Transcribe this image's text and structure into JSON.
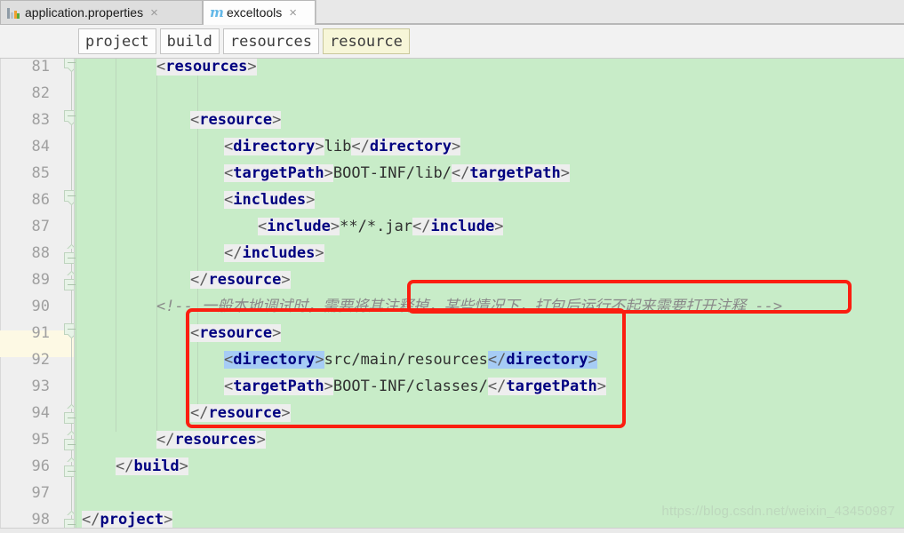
{
  "tabs": [
    {
      "label": "application.properties",
      "icon": "properties-file-icon",
      "close": "×",
      "active": false
    },
    {
      "label": "exceltools",
      "icon": "maven-module-icon",
      "close": "×",
      "active": true
    }
  ],
  "breadcrumbs": [
    {
      "label": "project",
      "current": false
    },
    {
      "label": "build",
      "current": false
    },
    {
      "label": "resources",
      "current": false
    },
    {
      "label": "resource",
      "current": true
    }
  ],
  "editor": {
    "language": "xml",
    "caret_line": 92,
    "colors": {
      "background": "#c8ecc8",
      "gutter": "#efefef",
      "caret_line": "#fdf9e4",
      "token": "#eeeeee",
      "tag": "#000080",
      "bracket": "#5a5a5a",
      "text": "#303030",
      "comment": "#8a8a8a",
      "selection": "#a6ccf5",
      "annotation": "#fb1e10"
    },
    "lines": [
      {
        "no": "81",
        "text": "        <resources>",
        "fold": "open",
        "bulb": false
      },
      {
        "no": "82",
        "text": "",
        "fold": "none",
        "bulb": false
      },
      {
        "no": "83",
        "text": "            <resource>",
        "fold": "open",
        "bulb": false
      },
      {
        "no": "84",
        "text": "                <directory>lib</directory>",
        "fold": "none",
        "bulb": false
      },
      {
        "no": "85",
        "text": "                <targetPath>BOOT-INF/lib/</targetPath>",
        "fold": "none",
        "bulb": false
      },
      {
        "no": "86",
        "text": "                <includes>",
        "fold": "open",
        "bulb": false
      },
      {
        "no": "87",
        "text": "                    <include>**/*.jar</include>",
        "fold": "none",
        "bulb": false
      },
      {
        "no": "88",
        "text": "                </includes>",
        "fold": "close",
        "bulb": false
      },
      {
        "no": "89",
        "text": "            </resource>",
        "fold": "close",
        "bulb": false
      },
      {
        "no": "90",
        "text": "        <!-- 一般本地调试时，需要将其注释掉，某些情况下，打包后运行不起来需要打开注释 -->",
        "fold": "none",
        "bulb": false
      },
      {
        "no": "91",
        "text": "            <resource>",
        "fold": "open",
        "bulb": false
      },
      {
        "no": "92",
        "text": "                <directory>src/main/resources</directory>",
        "fold": "none",
        "bulb": true
      },
      {
        "no": "93",
        "text": "                <targetPath>BOOT-INF/classes/</targetPath>",
        "fold": "none",
        "bulb": false
      },
      {
        "no": "94",
        "text": "            </resource>",
        "fold": "close",
        "bulb": false
      },
      {
        "no": "95",
        "text": "        </resources>",
        "fold": "close",
        "bulb": false
      },
      {
        "no": "96",
        "text": "    </build>",
        "fold": "close",
        "bulb": false
      },
      {
        "no": "97",
        "text": "",
        "fold": "none",
        "bulb": false
      },
      {
        "no": "98",
        "text": "</project>",
        "fold": "close",
        "bulb": false
      }
    ],
    "code_lines": {
      "l81": [
        {
          "t": "br",
          "v": "<"
        },
        {
          "t": "tag",
          "v": "resources"
        },
        {
          "t": "br",
          "v": ">"
        }
      ],
      "l83": [
        {
          "t": "br",
          "v": "<"
        },
        {
          "t": "tag",
          "v": "resource"
        },
        {
          "t": "br",
          "v": ">"
        }
      ],
      "l84_a": [
        {
          "t": "br",
          "v": "<"
        },
        {
          "t": "tag",
          "v": "directory"
        },
        {
          "t": "br",
          "v": ">"
        }
      ],
      "l84_b": "lib",
      "l84_c": [
        {
          "t": "br",
          "v": "</"
        },
        {
          "t": "tag",
          "v": "directory"
        },
        {
          "t": "br",
          "v": ">"
        }
      ],
      "l85_a": [
        {
          "t": "br",
          "v": "<"
        },
        {
          "t": "tag",
          "v": "targetPath"
        },
        {
          "t": "br",
          "v": ">"
        }
      ],
      "l85_b": "BOOT-INF/lib/",
      "l85_c": [
        {
          "t": "br",
          "v": "</"
        },
        {
          "t": "tag",
          "v": "targetPath"
        },
        {
          "t": "br",
          "v": ">"
        }
      ],
      "l86": [
        {
          "t": "br",
          "v": "<"
        },
        {
          "t": "tag",
          "v": "includes"
        },
        {
          "t": "br",
          "v": ">"
        }
      ],
      "l87_a": [
        {
          "t": "br",
          "v": "<"
        },
        {
          "t": "tag",
          "v": "include"
        },
        {
          "t": "br",
          "v": ">"
        }
      ],
      "l87_b": "**/*.jar",
      "l87_c": [
        {
          "t": "br",
          "v": "</"
        },
        {
          "t": "tag",
          "v": "include"
        },
        {
          "t": "br",
          "v": ">"
        }
      ],
      "l88": [
        {
          "t": "br",
          "v": "</"
        },
        {
          "t": "tag",
          "v": "includes"
        },
        {
          "t": "br",
          "v": ">"
        }
      ],
      "l89": [
        {
          "t": "br",
          "v": "</"
        },
        {
          "t": "tag",
          "v": "resource"
        },
        {
          "t": "br",
          "v": ">"
        }
      ],
      "l90_a": "<!-- 一般本地调试时，需要将其注释掉，",
      "l90_b": "某些情况下，打包后运行不起来需要打开注释",
      "l90_c": " -->",
      "l91": [
        {
          "t": "br",
          "v": "<"
        },
        {
          "t": "tag",
          "v": "resource"
        },
        {
          "t": "br",
          "v": ">"
        }
      ],
      "l92_a": [
        {
          "t": "br",
          "v": "<"
        },
        {
          "t": "tag",
          "v": "directory"
        },
        {
          "t": "br",
          "v": ">"
        }
      ],
      "l92_b": "src/main/resources",
      "l92_c": [
        {
          "t": "br",
          "v": "</"
        },
        {
          "t": "tag",
          "v": "directory"
        },
        {
          "t": "br",
          "v": ">"
        }
      ],
      "l93_a": [
        {
          "t": "br",
          "v": "<"
        },
        {
          "t": "tag",
          "v": "targetPath"
        },
        {
          "t": "br",
          "v": ">"
        }
      ],
      "l93_b": "BOOT-INF/classes/",
      "l93_c": [
        {
          "t": "br",
          "v": "</"
        },
        {
          "t": "tag",
          "v": "targetPath"
        },
        {
          "t": "br",
          "v": ">"
        }
      ],
      "l94": [
        {
          "t": "br",
          "v": "</"
        },
        {
          "t": "tag",
          "v": "resource"
        },
        {
          "t": "br",
          "v": ">"
        }
      ],
      "l95": [
        {
          "t": "br",
          "v": "</"
        },
        {
          "t": "tag",
          "v": "resources"
        },
        {
          "t": "br",
          "v": ">"
        }
      ],
      "l96": [
        {
          "t": "br",
          "v": "</"
        },
        {
          "t": "tag",
          "v": "build"
        },
        {
          "t": "br",
          "v": ">"
        }
      ],
      "l98": [
        {
          "t": "br",
          "v": "</"
        },
        {
          "t": "tag",
          "v": "project"
        },
        {
          "t": "br",
          "v": ">"
        }
      ]
    }
  },
  "annotations": [
    {
      "name": "comment-highlight-box"
    },
    {
      "name": "resource-block-box"
    }
  ],
  "watermark": "https://blog.csdn.net/weixin_43450987"
}
